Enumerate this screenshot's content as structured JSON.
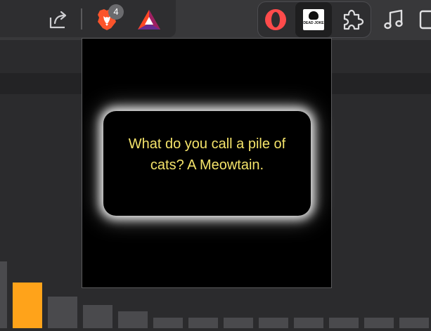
{
  "toolbar": {
    "share_icon": "share-icon",
    "brave_shields_icon": "brave-lion-icon",
    "shields_badge_count": "4",
    "rewards_icon": "bat-triangle-icon",
    "extensions": [
      {
        "name": "opera-circle-icon"
      },
      {
        "name": "dead-joke-extension-icon",
        "logo_text": "DEAD JOKE"
      },
      {
        "name": "puzzle-icon"
      }
    ],
    "music_icon": "music-note-icon",
    "colors": {
      "toolbar_bg": "#38383a",
      "badge_bg": "#6b6b6e",
      "opera_red": "#ff4b4b"
    }
  },
  "popup": {
    "joke": "What do you call a pile of cats? A Meowtain.",
    "emoji": "😂",
    "colors": {
      "background": "#000000",
      "text": "#f4e36a",
      "glow": "#ffffff"
    }
  },
  "background_bars": {
    "accent_color": "#ffa31a",
    "bar_color": "#4a4a4d",
    "values": [
      0.95,
      0.65,
      0.45,
      0.33,
      0.24,
      0.15,
      0.15,
      0.15,
      0.15,
      0.15,
      0.15,
      0.15,
      0.15
    ],
    "highlighted_index": 1
  }
}
